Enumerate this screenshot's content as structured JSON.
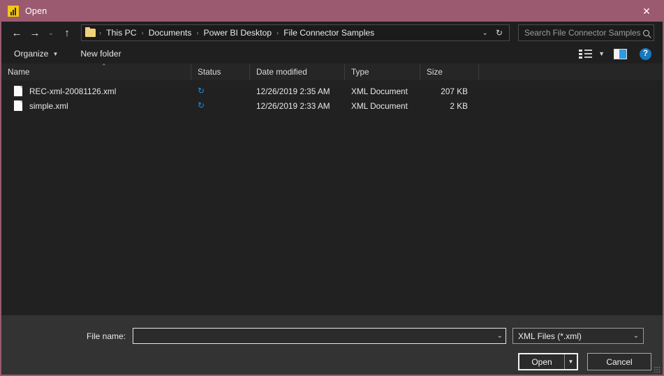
{
  "window": {
    "title": "Open",
    "app_icon": "powerbi-bar-chart-icon",
    "close_label": "✕",
    "titlebar_color": "#9b5a70"
  },
  "navbar": {
    "back_icon": "←",
    "forward_icon": "→",
    "recent_icon": "⌄",
    "up_icon": "↑",
    "breadcrumbs": [
      "This PC",
      "Documents",
      "Power BI Desktop",
      "File Connector Samples"
    ],
    "separator": "›",
    "dropdown_icon": "⌄",
    "refresh_icon": "↻"
  },
  "search": {
    "placeholder": "Search File Connector Samples",
    "value": ""
  },
  "commandbar": {
    "organize_label": "Organize",
    "organize_caret": "▼",
    "new_folder_label": "New folder",
    "view_caret": "▼",
    "help_label": "?"
  },
  "columns": {
    "name": "Name",
    "status": "Status",
    "date_modified": "Date modified",
    "type": "Type",
    "size": "Size",
    "sort_caret": "⌃"
  },
  "files": [
    {
      "name": "REC-xml-20081126.xml",
      "status_icon": "↻",
      "date_modified": "12/26/2019 2:35 AM",
      "type": "XML Document",
      "size": "207 KB"
    },
    {
      "name": "simple.xml",
      "status_icon": "↻",
      "date_modified": "12/26/2019 2:33 AM",
      "type": "XML Document",
      "size": "2 KB"
    }
  ],
  "footer": {
    "filename_label": "File name:",
    "filename_value": "",
    "filename_caret": "⌄",
    "filter_value": "XML Files (*.xml)",
    "filter_caret": "⌄",
    "open_label": "Open",
    "open_split_caret": "▼",
    "cancel_label": "Cancel"
  }
}
